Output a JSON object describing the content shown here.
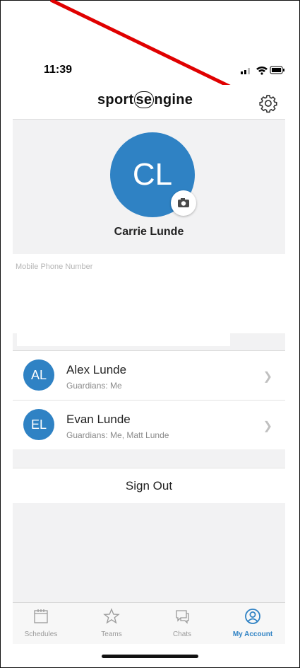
{
  "status_bar": {
    "time": "11:39"
  },
  "header": {
    "logo": {
      "part1": "sport",
      "part2": "se",
      "part3": "ngine"
    }
  },
  "profile": {
    "initials": "CL",
    "name": "Carrie Lunde"
  },
  "contact": {
    "phone_label": "Mobile Phone Number"
  },
  "guardians": [
    {
      "initials": "AL",
      "name": "Alex Lunde",
      "subtitle": "Guardians: Me"
    },
    {
      "initials": "EL",
      "name": "Evan Lunde",
      "subtitle": "Guardians: Me, Matt Lunde"
    }
  ],
  "actions": {
    "sign_out": "Sign Out"
  },
  "tabs": [
    {
      "label": "Schedules",
      "icon": "calendar-icon"
    },
    {
      "label": "Teams",
      "icon": "star-icon"
    },
    {
      "label": "Chats",
      "icon": "chat-icon"
    },
    {
      "label": "My Account",
      "icon": "user-circle-icon",
      "active": true
    }
  ],
  "colors": {
    "accent": "#2f82c4",
    "annotation_arrow": "#e00000"
  }
}
